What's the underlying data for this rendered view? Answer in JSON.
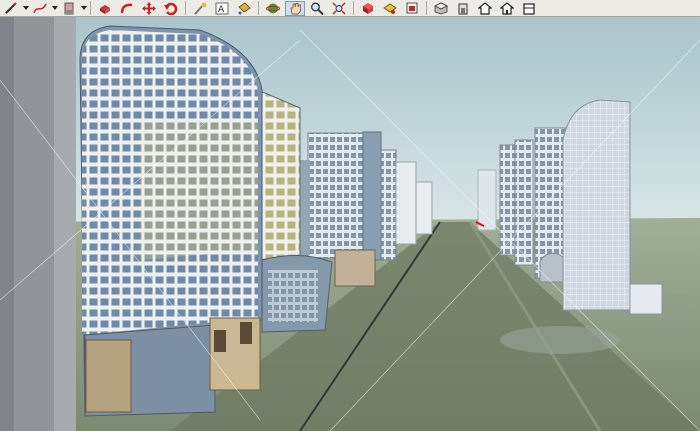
{
  "toolbar": {
    "groups": [
      [
        "pencil-icon",
        "freehand-icon",
        "eraser-icon"
      ],
      [
        "push-pull-icon",
        "follow-me-icon",
        "move-icon",
        "rotate-icon"
      ],
      [
        "tape-measure-icon",
        "text-icon",
        "paint-bucket-icon"
      ],
      [
        "orbit-icon",
        "pan-icon",
        "zoom-icon",
        "zoom-extents-icon"
      ],
      [
        "component-icon",
        "material-icon",
        "section-icon"
      ],
      [
        "iso-view-icon",
        "front-view-icon",
        "top-view-icon",
        "right-view-icon",
        "back-view-icon"
      ]
    ],
    "active_tool": "pan-icon"
  },
  "colors": {
    "sky_top": "#a9c4cb",
    "sky_bottom": "#d7e5e6",
    "ground": "#8c9a80",
    "road": "#5f6a55",
    "axis_red": "#ff0000",
    "tool_active": "#cfdcea"
  }
}
